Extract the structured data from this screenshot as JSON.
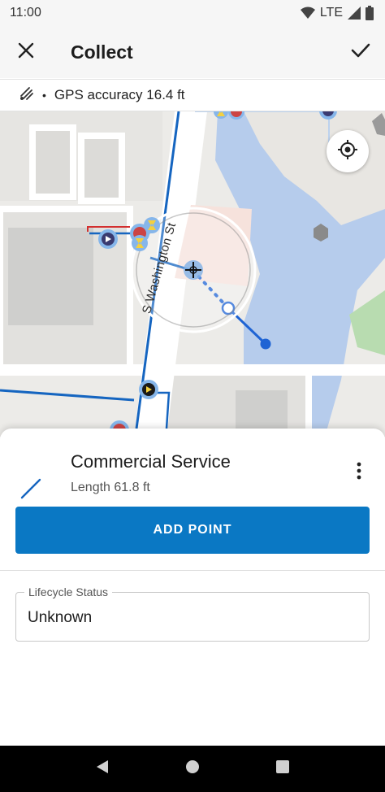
{
  "status_bar": {
    "time": "11:00",
    "network": "LTE"
  },
  "app_bar": {
    "title": "Collect"
  },
  "gps": {
    "label": "GPS accuracy 16.4 ft"
  },
  "map": {
    "street_name": "S Washington St"
  },
  "feature": {
    "name": "Commercial Service",
    "length": "Length 61.8 ft"
  },
  "actions": {
    "add_point": "ADD POINT"
  },
  "fields": [
    {
      "label": "Lifecycle Status",
      "value": "Unknown"
    }
  ],
  "colors": {
    "accent": "#0a78c4",
    "line": "#1565c0",
    "water": "#b6ccec"
  },
  "icons": {
    "close": "close-icon",
    "confirm": "check-icon",
    "gps": "gps-signal-icon",
    "locate": "my-location-icon",
    "feature": "polyline-icon",
    "more": "more-vert-icon"
  }
}
